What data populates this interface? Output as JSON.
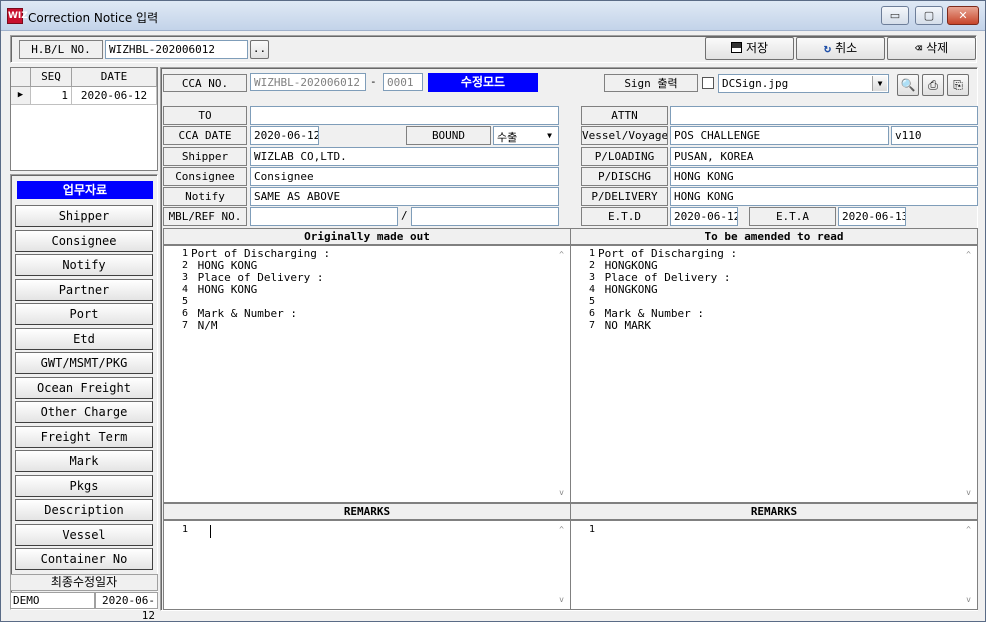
{
  "window": {
    "title": "Correction Notice 입력",
    "app_icon": "WIZ",
    "controls": {
      "minimize": "▭",
      "restore": "▢",
      "close": "✕"
    }
  },
  "header": {
    "hbl_label": "H.B/L NO.",
    "hbl_value": "WIZHBL-202006012",
    "browse_label": "..",
    "save_label": "저장",
    "cancel_label": "취소",
    "delete_label": "삭제"
  },
  "history": {
    "columns": [
      "SEQ",
      "DATE"
    ],
    "rows": [
      {
        "seq": "1",
        "date": "2020-06-12"
      }
    ]
  },
  "sidebar": {
    "section_label": "업무자료",
    "items": [
      "Shipper",
      "Consignee",
      "Notify",
      "Partner",
      "Port",
      "Etd",
      "GWT/MSMT/PKG",
      "Ocean Freight",
      "Other Charge",
      "Freight Term",
      "Mark",
      "Pkgs",
      "Description",
      "Vessel",
      "Container No"
    ],
    "last_modified_label": "최종수정일자",
    "last_modified_user": "DEMO",
    "last_modified_date": "2020-06-12"
  },
  "cca": {
    "cca_no_label": "CCA NO.",
    "cca_no_value": "WIZHBL-202006012",
    "dash": "-",
    "cca_seq": "0001",
    "mode_label": "수정모드",
    "sign_print_label": "Sign 출력",
    "sign_file": "DCSign.jpg"
  },
  "form": {
    "to_label": "TO",
    "to_value": "",
    "cca_date_label": "CCA DATE",
    "cca_date_value": "2020-06-12",
    "bound_label": "BOUND",
    "bound_value": "수출",
    "shipper_label": "Shipper",
    "shipper_value": "WIZLAB CO,LTD.",
    "consignee_label": "Consignee",
    "consignee_value": "Consignee",
    "notify_label": "Notify",
    "notify_value": "SAME AS ABOVE",
    "mbl_label": "MBL/REF NO.",
    "mbl_value1": "",
    "slash": "/",
    "mbl_value2": "",
    "attn_label": "ATTN",
    "attn_value": "",
    "vessel_label": "Vessel/Voyage",
    "vessel_value": "POS CHALLENGE",
    "voyage_value": "v110",
    "loading_label": "P/LOADING",
    "loading_value": "PUSAN, KOREA",
    "dischg_label": "P/DISCHG",
    "dischg_value": "HONG KONG",
    "delivery_label": "P/DELIVERY",
    "delivery_value": "HONG KONG",
    "etd_label": "E.T.D",
    "etd_value": "2020-06-12",
    "eta_label": "E.T.A",
    "eta_value": "2020-06-13"
  },
  "original": {
    "header": "Originally made out",
    "lines": [
      "Port of Discharging :",
      " HONG KONG",
      " Place of Delivery :",
      " HONG KONG",
      "",
      " Mark & Number :",
      " N/M"
    ]
  },
  "amended": {
    "header": "To be amended to read",
    "lines": [
      "Port of Discharging :",
      " HONGKONG",
      " Place of Delivery :",
      " HONGKONG",
      "",
      " Mark & Number :",
      " NO MARK"
    ]
  },
  "remarks_left": {
    "header": "REMARKS",
    "line_no": "1"
  },
  "remarks_right": {
    "header": "REMARKS",
    "line_no": "1"
  },
  "icons": {
    "up_arrow": "^",
    "down_arrow": "v",
    "row_pointer": "▶",
    "combo_arrow": "▼"
  }
}
